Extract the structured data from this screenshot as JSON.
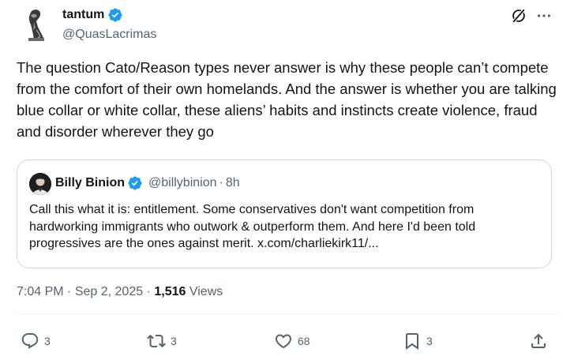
{
  "author": {
    "name": "tantum",
    "handle": "@QuasLacrimas",
    "verified": true
  },
  "post": {
    "text": "The question Cato/Reason types never answer is why these people can’t compete from the comfort of their own homelands. And the answer is whether you are talking blue collar or white collar, these aliens’ habits and instincts create violence, fraud and disorder wherever they go"
  },
  "quote": {
    "name": "Billy Binion",
    "handle": "@billybinion",
    "separator": "·",
    "time": "8h",
    "verified": true,
    "text": "Call this what it is: entitlement. Some conservatives don't want competition from hardworking immigrants who outwork & outperform them. And here I'd been told progressives are the ones against merit. x.com/charliekirk11/..."
  },
  "meta": {
    "time": "7:04 PM",
    "separator": "·",
    "date": "Sep 2, 2025",
    "views_count": "1,516",
    "views_label": "Views"
  },
  "actions": {
    "replies": "3",
    "reposts": "3",
    "likes": "68",
    "bookmarks": "3"
  },
  "colors": {
    "verified_blue": "#1d9bf0",
    "secondary_text": "#536471",
    "primary_text": "#0f1419",
    "border": "#cfd9de"
  },
  "icons": {
    "header": [
      "grok-icon",
      "more-icon"
    ],
    "actions": [
      "reply-icon",
      "repost-icon",
      "like-icon",
      "bookmark-icon",
      "share-icon"
    ]
  }
}
